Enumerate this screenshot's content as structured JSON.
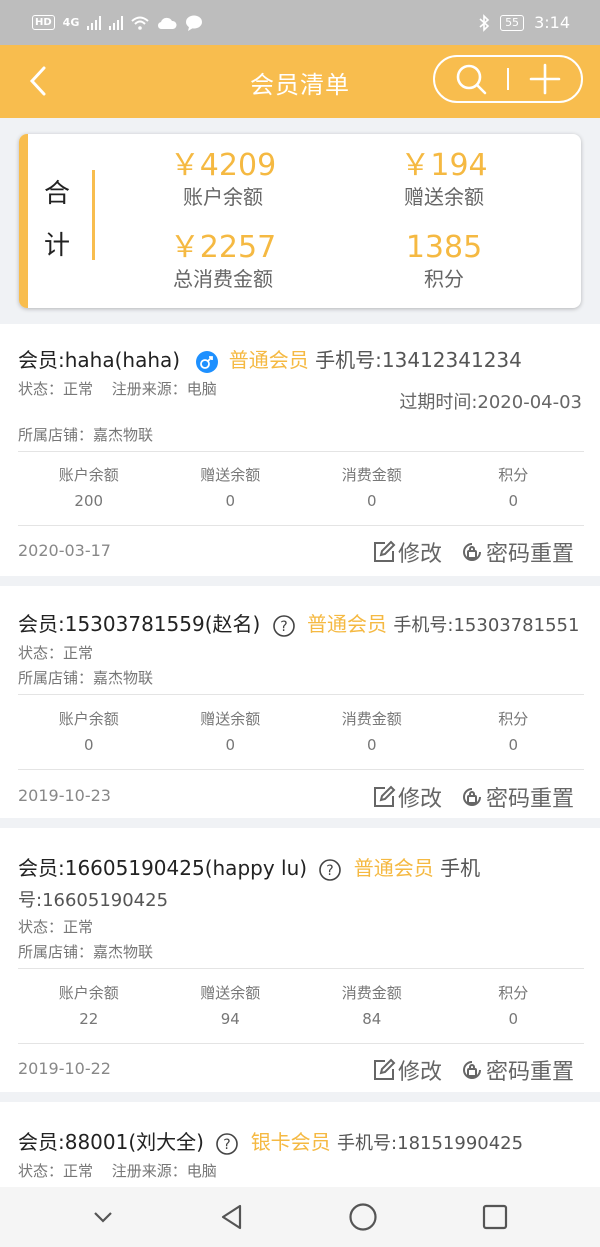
{
  "status_bar": {
    "hd": "HD",
    "network": "4G",
    "battery": "55",
    "time": "3:14"
  },
  "header": {
    "title": "会员清单",
    "back_icon": "chevron-left-icon",
    "search_icon": "search-icon",
    "add_icon": "plus-icon"
  },
  "colors": {
    "accent": "#f8bd4e",
    "value": "#f5b942",
    "male_badge": "#1e90ff"
  },
  "summary": {
    "label": "合计",
    "account_balance": {
      "value": "￥4209",
      "label": "账户余额"
    },
    "gift_balance": {
      "value": "￥194",
      "label": "赠送余额"
    },
    "total_spent": {
      "value": "￥2257",
      "label": "总消费金额"
    },
    "points": {
      "value": "1385",
      "label": "积分"
    }
  },
  "stat_labels": {
    "account": "账户余额",
    "gift": "赠送余额",
    "spent": "消费金额",
    "points": "积分"
  },
  "actions": {
    "edit": "修改",
    "reset": "密码重置"
  },
  "members": [
    {
      "name": "会员:haha(haha)",
      "gender_icon": "male-icon",
      "level": "普通会员",
      "phone": "手机号:13412341234",
      "status": "状态：正常",
      "source": "注册来源：电脑",
      "expire": "过期时间:2020-04-03",
      "store": "所属店铺：嘉杰物联",
      "balances": {
        "account": "200",
        "gift": "0",
        "spent": "0",
        "points": "0"
      },
      "date": "2020-03-17"
    },
    {
      "name": "会员:15303781559(赵名)",
      "gender_icon": "question-icon",
      "level": "普通会员",
      "phone": "手机号:15303781551",
      "status": "状态：正常",
      "store": "所属店铺：嘉杰物联",
      "balances": {
        "account": "0",
        "gift": "0",
        "spent": "0",
        "points": "0"
      },
      "date": "2019-10-23"
    },
    {
      "name": "会员:16605190425(happy lu)",
      "gender_icon": "question-icon",
      "level": "普通会员",
      "phone_a": "手机",
      "phone_b": "号:16605190425",
      "status": "状态：正常",
      "store": "所属店铺：嘉杰物联",
      "balances": {
        "account": "22",
        "gift": "94",
        "spent": "84",
        "points": "0"
      },
      "date": "2019-10-22"
    },
    {
      "name": "会员:88001(刘大全)",
      "gender_icon": "question-icon",
      "level": "银卡会员",
      "phone": "手机号:18151990425",
      "status": "状态：正常",
      "source": "注册来源：电脑"
    }
  ]
}
